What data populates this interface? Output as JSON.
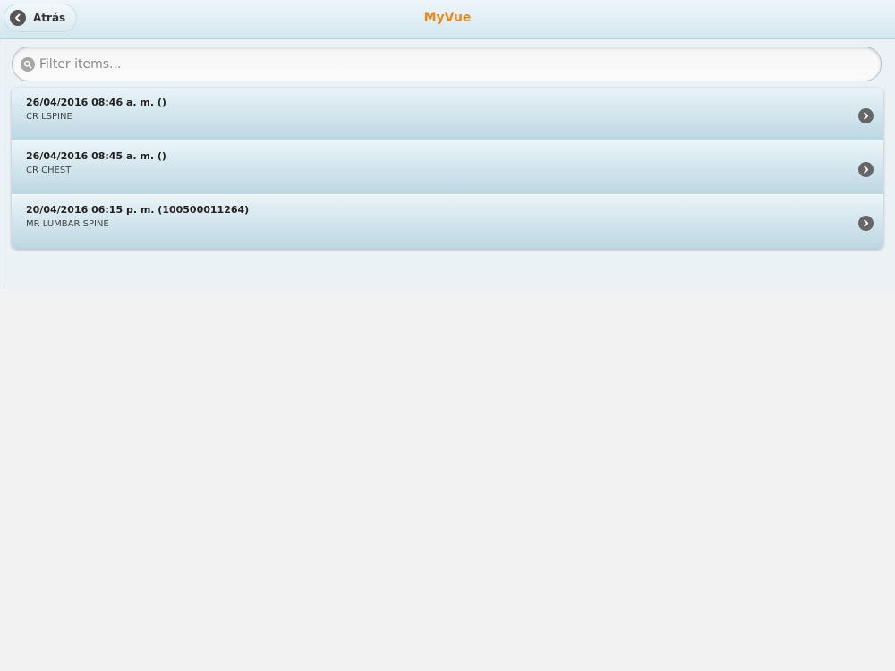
{
  "header": {
    "back_label": "Atrás",
    "title": "MyVue",
    "title_color": "#e8891c"
  },
  "search": {
    "placeholder": "Filter items...",
    "icon": "search-icon"
  },
  "studies": [
    {
      "date": "26/04/2016 08:46 a. m. ()",
      "description": "CR LSPINE",
      "icon": "chevron-right-icon"
    },
    {
      "date": "26/04/2016 08:45 a. m. ()",
      "description": "CR CHEST",
      "icon": "chevron-right-icon"
    },
    {
      "date": "20/04/2016 06:15 p. m. (100500011264)",
      "description": "MR LUMBAR SPINE",
      "icon": "chevron-right-icon"
    }
  ]
}
